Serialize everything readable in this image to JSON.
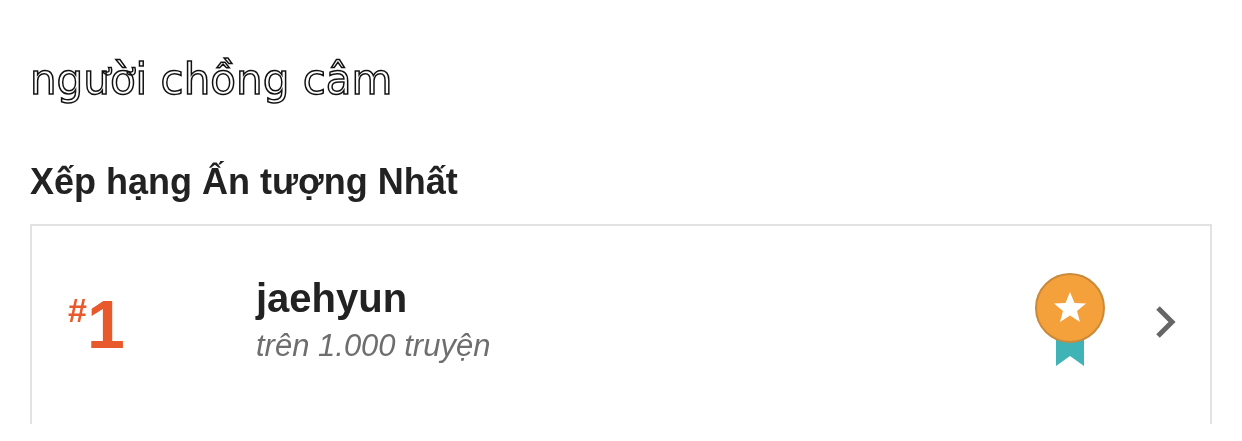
{
  "title": "người chồng câm",
  "section_heading": "Xếp hạng Ấn tượng Nhất",
  "rankings": [
    {
      "rank_prefix": "#",
      "rank": "1",
      "name": "jaehyun",
      "subtitle": "trên 1.000 truyện"
    }
  ]
}
